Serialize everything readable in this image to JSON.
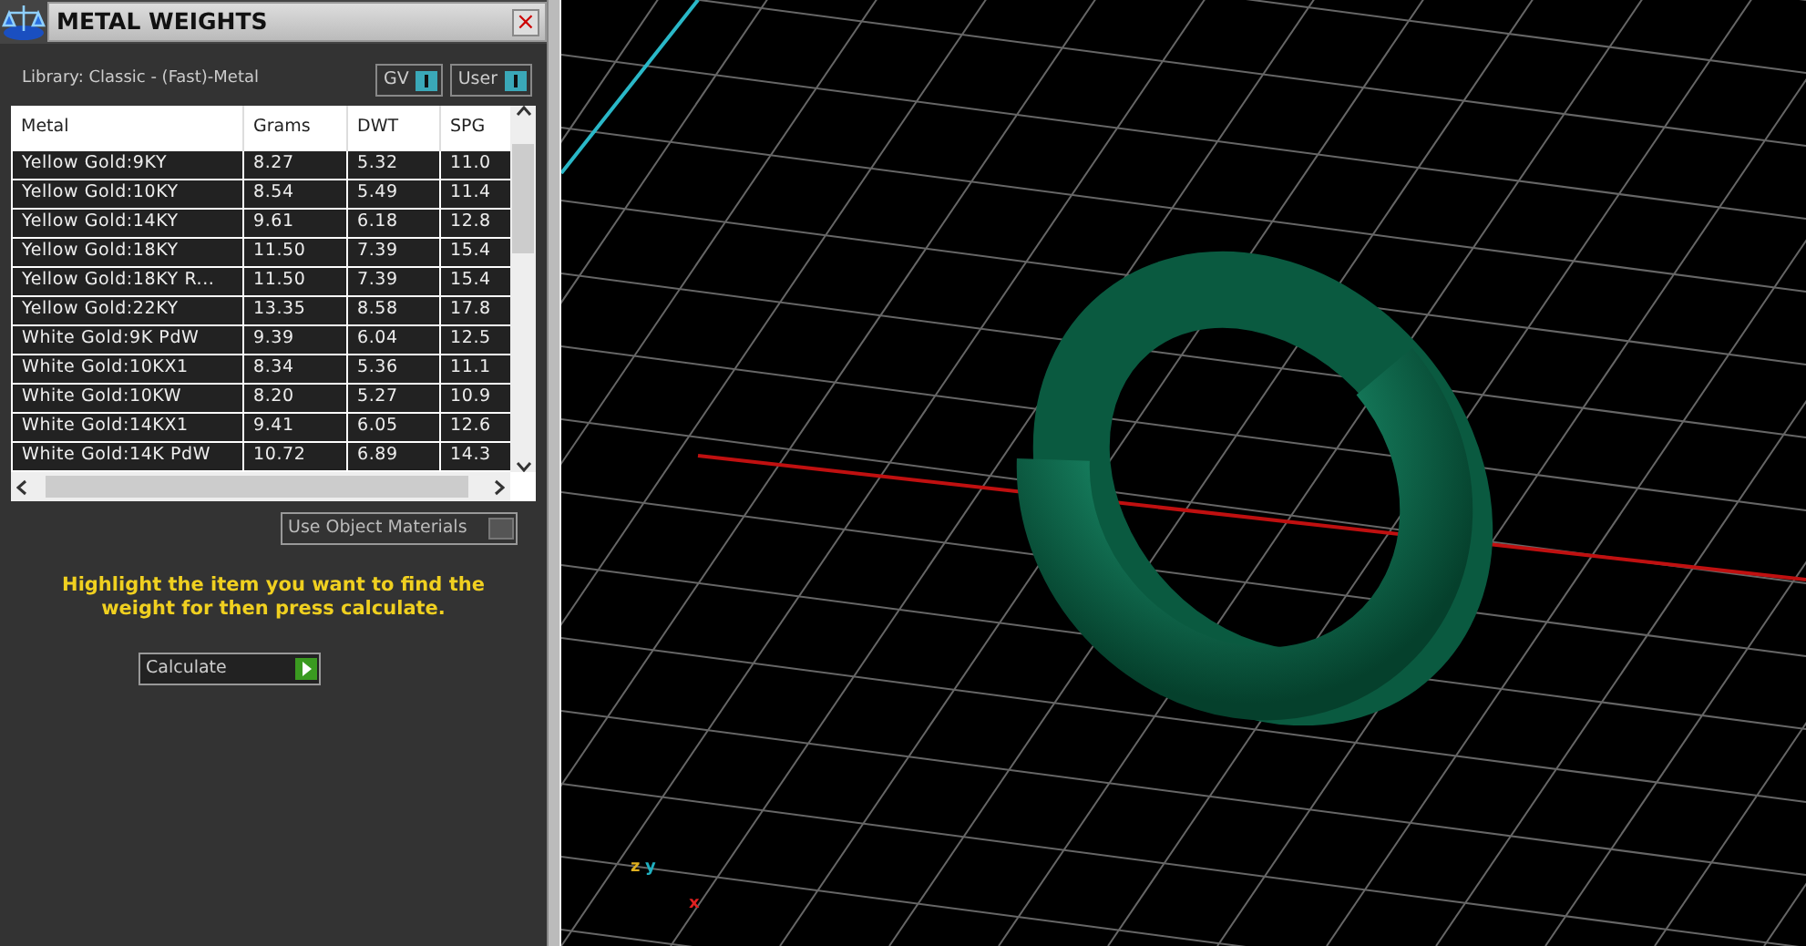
{
  "panel": {
    "title": "METAL WEIGHTS",
    "close": "×",
    "library": "Library: Classic - (Fast)-Metal",
    "toggles": [
      {
        "label": "GV",
        "on": true
      },
      {
        "label": "User",
        "on": true
      }
    ],
    "table": {
      "columns": [
        "Metal",
        "Grams",
        "DWT",
        "SPG"
      ],
      "rows": [
        [
          "Yellow Gold:9KY",
          "8.27",
          "5.32",
          "11.0"
        ],
        [
          "Yellow Gold:10KY",
          "8.54",
          "5.49",
          "11.4"
        ],
        [
          "Yellow Gold:14KY",
          "9.61",
          "6.18",
          "12.8"
        ],
        [
          "Yellow Gold:18KY",
          "11.50",
          "7.39",
          "15.4"
        ],
        [
          "Yellow Gold:18KY R...",
          "11.50",
          "7.39",
          "15.4"
        ],
        [
          "Yellow Gold:22KY",
          "13.35",
          "8.58",
          "17.8"
        ],
        [
          "White Gold:9K PdW",
          "9.39",
          "6.04",
          "12.5"
        ],
        [
          "White Gold:10KX1",
          "8.34",
          "5.36",
          "11.1"
        ],
        [
          "White Gold:10KW",
          "8.20",
          "5.27",
          "10.9"
        ],
        [
          "White Gold:14KX1",
          "9.41",
          "6.05",
          "12.6"
        ],
        [
          "White Gold:14K PdW",
          "10.72",
          "6.89",
          "14.3"
        ]
      ]
    },
    "use_object_materials": {
      "label": "Use Object Materials",
      "on": false
    },
    "hint": "Highlight the item you want to find the weight for then press calculate.",
    "calculate": "Calculate"
  },
  "viewport": {
    "axes": [
      {
        "label": "z",
        "color": "#e0b020"
      },
      {
        "label": "y",
        "color": "#20b0c0"
      },
      {
        "label": "x",
        "color": "#e02020"
      }
    ]
  }
}
